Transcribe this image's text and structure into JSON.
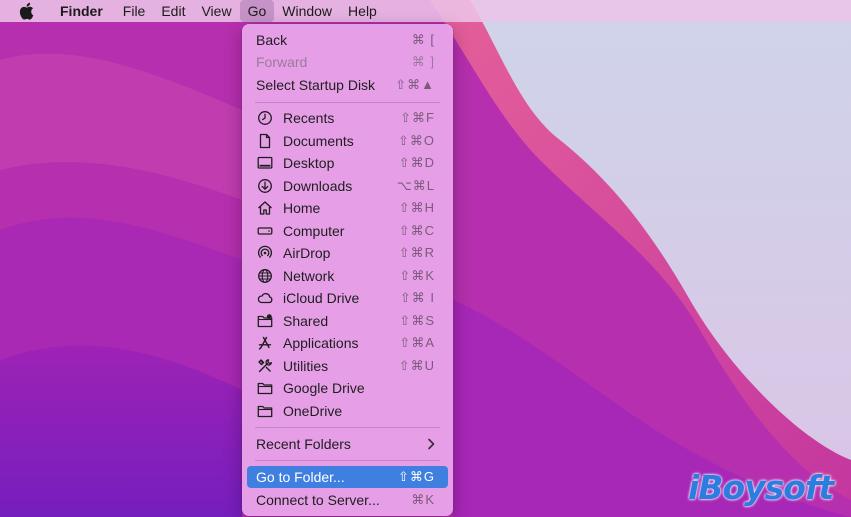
{
  "menubar": {
    "apple_icon": "apple-logo",
    "app_name": "Finder",
    "items": [
      "File",
      "Edit",
      "View",
      "Go",
      "Window",
      "Help"
    ],
    "active_item": "Go"
  },
  "go_menu": {
    "items": [
      {
        "label": "Back",
        "shortcut": "⌘ [",
        "enabled": true
      },
      {
        "label": "Forward",
        "shortcut": "⌘ ]",
        "enabled": false
      },
      {
        "label": "Select Startup Disk",
        "shortcut": "⇧⌘▲",
        "enabled": true
      },
      {
        "label": "Recents",
        "shortcut": "⇧⌘F",
        "icon": "clock-icon"
      },
      {
        "label": "Documents",
        "shortcut": "⇧⌘O",
        "icon": "document-icon"
      },
      {
        "label": "Desktop",
        "shortcut": "⇧⌘D",
        "icon": "desktop-icon"
      },
      {
        "label": "Downloads",
        "shortcut": "⌥⌘L",
        "icon": "download-icon"
      },
      {
        "label": "Home",
        "shortcut": "⇧⌘H",
        "icon": "home-icon"
      },
      {
        "label": "Computer",
        "shortcut": "⇧⌘C",
        "icon": "computer-icon"
      },
      {
        "label": "AirDrop",
        "shortcut": "⇧⌘R",
        "icon": "airdrop-icon"
      },
      {
        "label": "Network",
        "shortcut": "⇧⌘K",
        "icon": "network-globe-icon"
      },
      {
        "label": "iCloud Drive",
        "shortcut": "⇧⌘ I",
        "icon": "cloud-icon"
      },
      {
        "label": "Shared",
        "shortcut": "⇧⌘S",
        "icon": "shared-folder-icon"
      },
      {
        "label": "Applications",
        "shortcut": "⇧⌘A",
        "icon": "applications-icon"
      },
      {
        "label": "Utilities",
        "shortcut": "⇧⌘U",
        "icon": "utilities-tools-icon"
      },
      {
        "label": "Google Drive",
        "shortcut": "",
        "icon": "folder-icon"
      },
      {
        "label": "OneDrive",
        "shortcut": "",
        "icon": "folder-icon"
      },
      {
        "label": "Recent Folders",
        "submenu": true
      },
      {
        "label": "Go to Folder...",
        "shortcut": "⇧⌘G",
        "selected": true
      },
      {
        "label": "Connect to Server...",
        "shortcut": "⌘K"
      }
    ]
  },
  "watermark": "iBoysoft",
  "colors": {
    "selection": "#3f7fe0",
    "menu_background": "#eaa8ec",
    "desktop_magenta": "#b72fb0",
    "watermark_blue": "#2b7de0"
  }
}
